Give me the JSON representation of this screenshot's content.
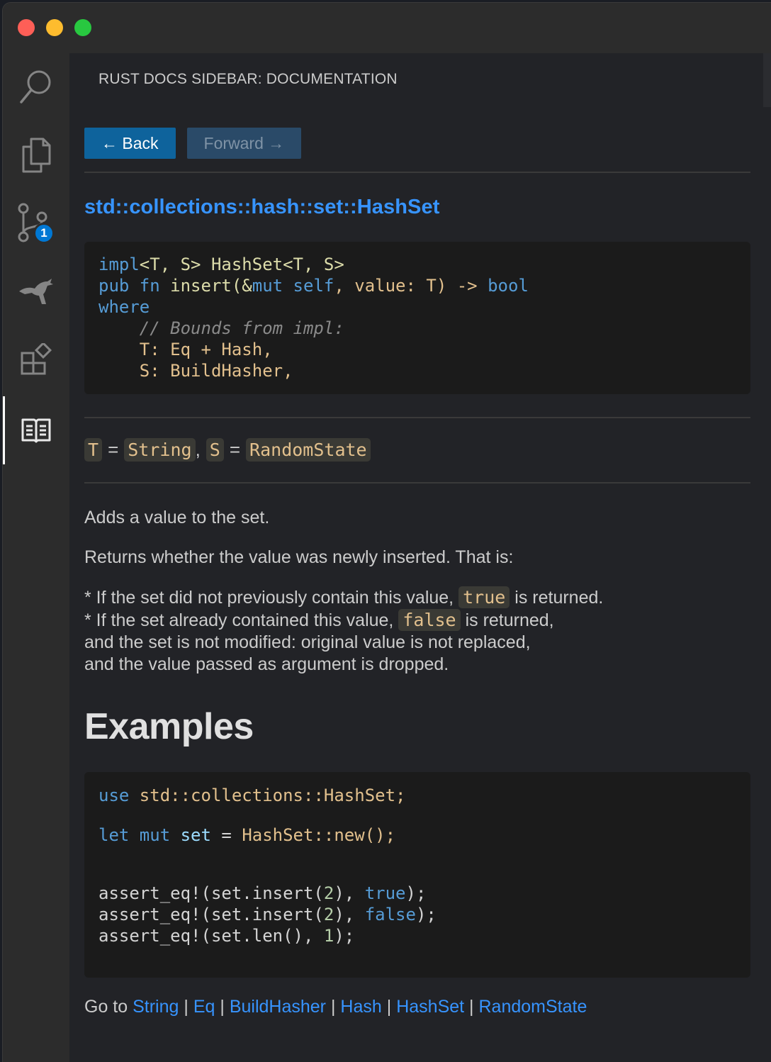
{
  "window": {
    "traffic_lights": [
      "close",
      "minimize",
      "zoom"
    ]
  },
  "activity_bar": {
    "items": [
      {
        "icon": "search-icon"
      },
      {
        "icon": "files-icon"
      },
      {
        "icon": "source-control-icon",
        "badge": "1"
      },
      {
        "icon": "kangaroo-icon"
      },
      {
        "icon": "extensions-icon"
      },
      {
        "icon": "book-icon",
        "active": true
      }
    ]
  },
  "panel": {
    "title": "RUST DOCS SIDEBAR: DOCUMENTATION"
  },
  "nav": {
    "back_label": "← Back",
    "forward_label": "Forward →"
  },
  "doc": {
    "path": "std::collections::hash::set::HashSet",
    "signature_lines": [
      "impl<T, S> HashSet<T, S>",
      "pub fn insert(&mut self, value: T) -> bool",
      "where",
      "    // Bounds from impl:",
      "    T: Eq + Hash,",
      "    S: BuildHasher,"
    ],
    "generics": {
      "t_name": "T",
      "t_value": "String",
      "s_name": "S",
      "s_value": "RandomState",
      "eq": "=",
      "comma": ","
    },
    "summary": "Adds a value to the set.",
    "returns": "Returns whether the value was newly inserted. That is:",
    "bullet1_pre": "* If the set did not previously contain this value,",
    "bullet1_code": "true",
    "bullet1_post": "is returned.",
    "bullet2_pre": "* If the set already contained this value,",
    "bullet2_code": "false",
    "bullet2_post": "is returned,",
    "bullet2_line2": "and the set is not modified: original value is not replaced,",
    "bullet2_line3": "and the value passed as argument is dropped.",
    "examples_heading": "Examples",
    "example_code": [
      "use std::collections::HashSet;",
      "",
      "let mut set = HashSet::new();",
      "",
      "",
      "assert_eq!(set.insert(2), true);",
      "assert_eq!(set.insert(2), false);",
      "assert_eq!(set.len(), 1);"
    ],
    "goto_label": "Go to",
    "goto_links": [
      "String",
      "Eq",
      "BuildHasher",
      "Hash",
      "HashSet",
      "RandomState"
    ],
    "goto_separator": "|"
  },
  "colors": {
    "accent": "#0e639c",
    "link": "#3794ff",
    "badge": "#0078d4"
  }
}
